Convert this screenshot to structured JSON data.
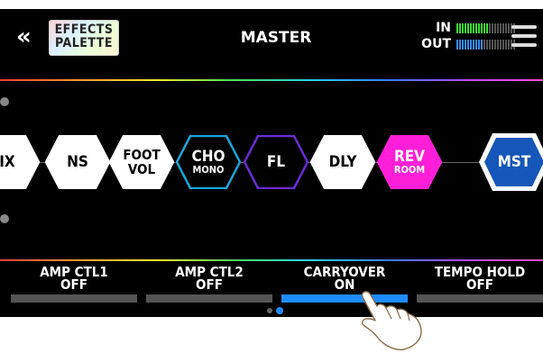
{
  "header": {
    "back_icon": "double-chevron-left-icon",
    "palette_line1": "EFFECTS",
    "palette_line2": "PALETTE",
    "title": "MASTER",
    "in_label": "IN",
    "out_label": "OUT",
    "in_level": 0.55,
    "out_level": 0.45,
    "menu_icon": "hamburger-menu-icon"
  },
  "chain": [
    {
      "main": "IX",
      "sub": ""
    },
    {
      "main": "NS",
      "sub": ""
    },
    {
      "main": "FOOT",
      "sub": "VOL"
    },
    {
      "main": "CHO",
      "sub": "MONO"
    },
    {
      "main": "FL",
      "sub": ""
    },
    {
      "main": "DLY",
      "sub": ""
    },
    {
      "main": "REV",
      "sub": "ROOM"
    },
    {
      "main": "MST",
      "sub": ""
    }
  ],
  "controls": [
    {
      "name": "AMP CTL1",
      "value": "OFF",
      "active": false
    },
    {
      "name": "AMP CTL2",
      "value": "OFF",
      "active": false
    },
    {
      "name": "CARRYOVER",
      "value": "ON",
      "active": true
    },
    {
      "name": "TEMPO HOLD",
      "value": "OFF",
      "active": false
    }
  ],
  "pages": {
    "count": 2,
    "current": 2
  },
  "colors": {
    "accent_blue": "#1e8cff",
    "cho_border": "#1aa6d8",
    "fl_border": "#6a2cd6",
    "rev_fill": "#ff1fd8",
    "mst_fill": "#1556b8",
    "in_meter": "#3fe13a",
    "out_meter": "#3a8cff"
  }
}
